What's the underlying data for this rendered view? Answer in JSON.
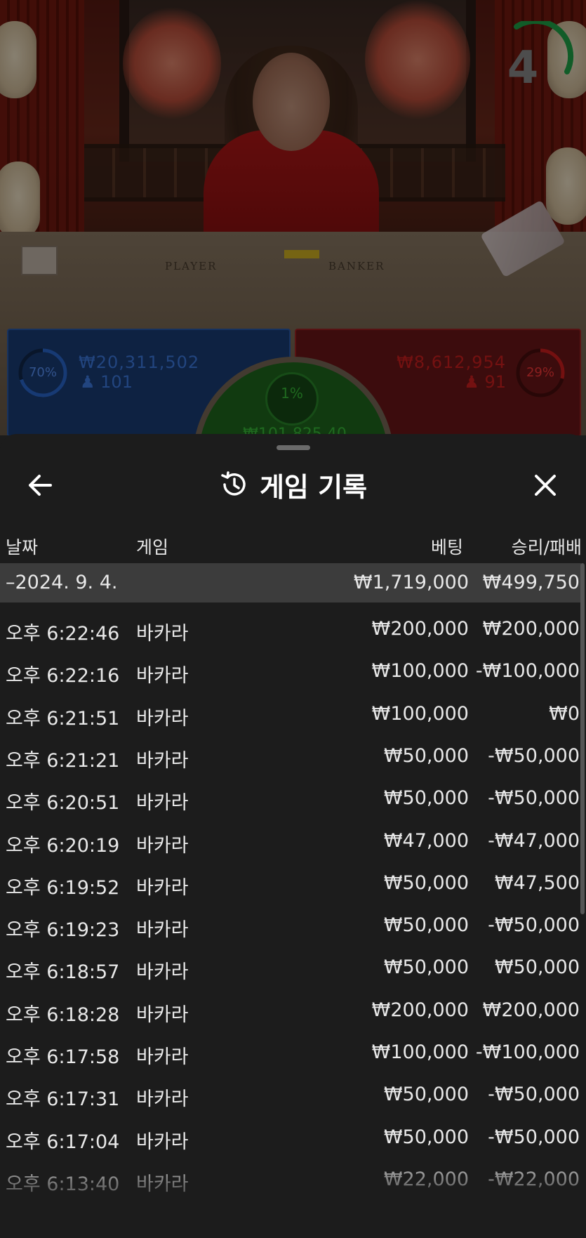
{
  "stream": {
    "timer_value": "4",
    "table_labels": {
      "player": "PLAYER",
      "banker": "BANKER"
    }
  },
  "bets": {
    "player": {
      "percent": "70%",
      "amount": "₩20,311,502",
      "players": "101",
      "color": "#2a6ad4"
    },
    "banker": {
      "percent": "29%",
      "amount": "₩8,612,954",
      "players": "91",
      "color": "#d41e1e"
    },
    "tie": {
      "percent": "1%",
      "amount": "₩101,825.40",
      "color": "#3ac03a"
    }
  },
  "sheet": {
    "title": "게임 기록",
    "back_icon": "arrow-left-icon",
    "close_icon": "close-icon",
    "title_icon": "history-icon",
    "columns": {
      "date": "날짜",
      "game": "게임",
      "bet": "베팅",
      "winloss": "승리/패배"
    },
    "date_group": {
      "label": "–2024. 9. 4.",
      "bet_total": "₩1,719,000",
      "winloss_total": "₩499,750"
    },
    "rows": [
      {
        "time": "오후 6:22:46",
        "game": "바카라",
        "bet": "₩200,000",
        "result": "₩200,000"
      },
      {
        "time": "오후 6:22:16",
        "game": "바카라",
        "bet": "₩100,000",
        "result": "-₩100,000"
      },
      {
        "time": "오후 6:21:51",
        "game": "바카라",
        "bet": "₩100,000",
        "result": "₩0"
      },
      {
        "time": "오후 6:21:21",
        "game": "바카라",
        "bet": "₩50,000",
        "result": "-₩50,000"
      },
      {
        "time": "오후 6:20:51",
        "game": "바카라",
        "bet": "₩50,000",
        "result": "-₩50,000"
      },
      {
        "time": "오후 6:20:19",
        "game": "바카라",
        "bet": "₩47,000",
        "result": "-₩47,000"
      },
      {
        "time": "오후 6:19:52",
        "game": "바카라",
        "bet": "₩50,000",
        "result": "₩47,500"
      },
      {
        "time": "오후 6:19:23",
        "game": "바카라",
        "bet": "₩50,000",
        "result": "-₩50,000"
      },
      {
        "time": "오후 6:18:57",
        "game": "바카라",
        "bet": "₩50,000",
        "result": "₩50,000"
      },
      {
        "time": "오후 6:18:28",
        "game": "바카라",
        "bet": "₩200,000",
        "result": "₩200,000"
      },
      {
        "time": "오후 6:17:58",
        "game": "바카라",
        "bet": "₩100,000",
        "result": "-₩100,000"
      },
      {
        "time": "오후 6:17:31",
        "game": "바카라",
        "bet": "₩50,000",
        "result": "-₩50,000"
      },
      {
        "time": "오후 6:17:04",
        "game": "바카라",
        "bet": "₩50,000",
        "result": "-₩50,000"
      },
      {
        "time": "오후 6:13:40",
        "game": "바카라",
        "bet": "₩22,000",
        "result": "-₩22,000"
      }
    ]
  }
}
